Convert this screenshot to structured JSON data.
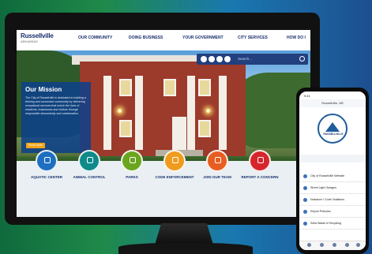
{
  "website": {
    "logo": {
      "title": "Russellville",
      "subtitle": "ARKANSAS"
    },
    "nav": [
      "OUR COMMUNITY",
      "DOING BUSINESS",
      "YOUR GOVERNMENT",
      "CITY SERVICES",
      "HOW DO I"
    ],
    "search": {
      "placeholder": "Search..."
    },
    "mission": {
      "title": "Our Mission",
      "text": "The City of Russellville is dedicated to building a thriving and connected community by delivering exceptional services that enrich the lives of residents, businesses and visitors through responsible stewardship and collaboration.",
      "button": "Read More"
    },
    "quick_links": [
      {
        "label": "AQUATIC CENTER",
        "color": "#1e6fc0",
        "icon": "wave-icon"
      },
      {
        "label": "ANIMAL CONTROL",
        "color": "#0f8a8a",
        "icon": "paw-icon"
      },
      {
        "label": "PARKS",
        "color": "#6aa51f",
        "icon": "tree-icon"
      },
      {
        "label": "CODE ENFORCEMENT",
        "color": "#ef9b1e",
        "icon": "badge-icon"
      },
      {
        "label": "JOIN OUR TEAM",
        "color": "#e85d21",
        "icon": "team-icon"
      },
      {
        "label": "REPORT A CONCERN",
        "color": "#d6262b",
        "icon": "alert-icon"
      }
    ]
  },
  "phone": {
    "status": "9:41",
    "header": "Russellville, AR",
    "badge": "RUSSELLVILLE",
    "items": [
      "City of Russellville Website",
      "Street Light Outages",
      "Nuisance / Code Violations",
      "Report Potholes",
      "Solid Waste & Recycling"
    ]
  }
}
